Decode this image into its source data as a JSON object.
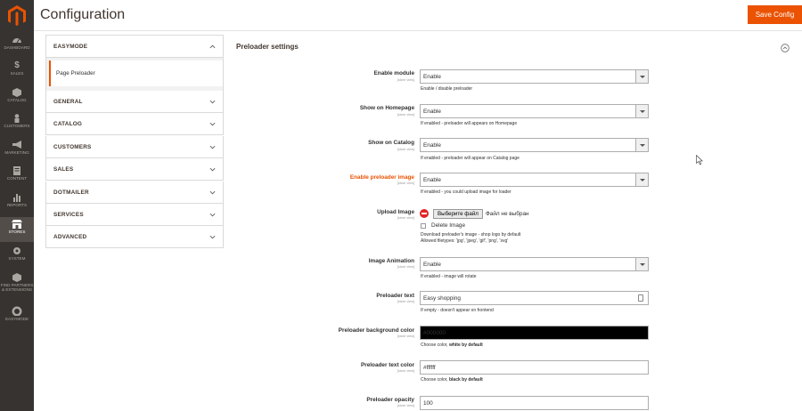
{
  "header": {
    "title": "Configuration",
    "save_label": "Save Config"
  },
  "nav": {
    "items": [
      {
        "label": "DASHBOARD",
        "icon": "dashboard-icon"
      },
      {
        "label": "SALES",
        "icon": "dollar-icon"
      },
      {
        "label": "CATALOG",
        "icon": "cube-icon"
      },
      {
        "label": "CUSTOMERS",
        "icon": "person-icon"
      },
      {
        "label": "MARKETING",
        "icon": "megaphone-icon"
      },
      {
        "label": "CONTENT",
        "icon": "content-icon"
      },
      {
        "label": "REPORTS",
        "icon": "bar-chart-icon"
      },
      {
        "label": "STORES",
        "icon": "store-icon"
      },
      {
        "label": "SYSTEM",
        "icon": "gear-icon"
      },
      {
        "label": "FIND PARTNERS & EXTENSIONS",
        "icon": "extensions-icon"
      },
      {
        "label": "EASYMODE",
        "icon": "easymode-icon"
      }
    ]
  },
  "sidebar": {
    "active_tab": "EASYMODE",
    "active_item": "Page Preloader",
    "tabs": [
      "GENERAL",
      "CATALOG",
      "CUSTOMERS",
      "SALES",
      "DOTMAILER",
      "SERVICES",
      "ADVANCED"
    ]
  },
  "section": {
    "title": "Preloader settings"
  },
  "scope_text": "[store view]",
  "fields": {
    "enable_module": {
      "label": "Enable module",
      "value": "Enable",
      "note": "Enable / disable preloader"
    },
    "show_homepage": {
      "label": "Show on Homepage",
      "value": "Enable",
      "note": "If enabled - preloader will appears on Homepage"
    },
    "show_catalog": {
      "label": "Show on Catalog",
      "value": "Enable",
      "note": "If enabled - preloader will appear on Catalog page"
    },
    "enable_image": {
      "label": "Enable preloader image",
      "value": "Enable",
      "note": "If enabled - you could upload image for loader"
    },
    "upload_image": {
      "label": "Upload Image",
      "button": "Выберите файл",
      "status": "Файл не выбран",
      "delete_label": "Delete Image",
      "note1": "Download preloader's image - shop logo by default",
      "note2": "Allowed filetypes: 'jpg', 'jpeg', 'gif', 'png', 'svg'"
    },
    "image_animation": {
      "label": "Image Animation",
      "value": "Enable",
      "note": "If enabled - image will rotate"
    },
    "preloader_text": {
      "label": "Preloader text",
      "value": "Easy shopping",
      "note": "If empty - doesn't appear on frontend"
    },
    "bg_color": {
      "label": "Preloader background color",
      "value": "#000000",
      "note_prefix": "Choose color, ",
      "note_bold": "white by default"
    },
    "text_color": {
      "label": "Preloader text color",
      "value": "#ffffff",
      "note_prefix": "Choose color, ",
      "note_bold": "black by default"
    },
    "opacity": {
      "label": "Preloader opacity",
      "value": "100"
    }
  },
  "colors": {
    "accent": "#eb5202",
    "nav_bg": "#373330",
    "bg_color_swatch": "#000000"
  }
}
